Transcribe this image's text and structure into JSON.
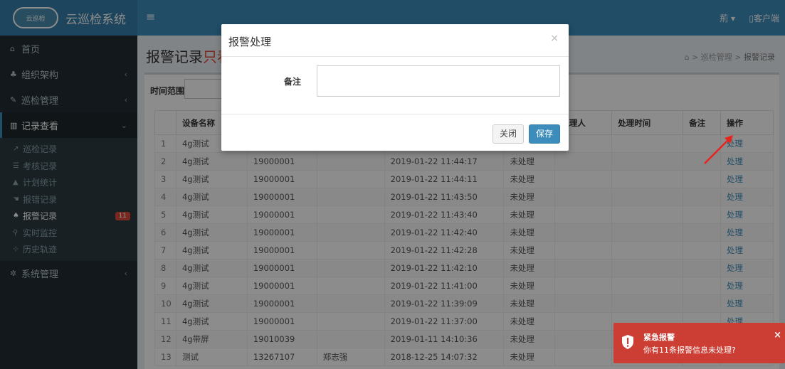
{
  "header": {
    "logo_text": "云巡检",
    "app_title": "云巡检系统",
    "menu_icon": "hamburger-icon",
    "user_label": "荊 ▾",
    "client_label": "客户端"
  },
  "sidebar": {
    "items": [
      {
        "label": "首页",
        "icon": "home-icon"
      },
      {
        "label": "组织架构",
        "icon": "sitemap-icon"
      },
      {
        "label": "巡检管理",
        "icon": "wrench-icon"
      },
      {
        "label": "记录查看",
        "icon": "chart-icon"
      },
      {
        "label": "系统管理",
        "icon": "gear-icon"
      }
    ],
    "sub_items": [
      {
        "label": "巡检记录",
        "icon": "line-chart-icon"
      },
      {
        "label": "考核记录",
        "icon": "list-icon"
      },
      {
        "label": "计划统计",
        "icon": "area-chart-icon"
      },
      {
        "label": "报错记录",
        "icon": "hand-icon"
      },
      {
        "label": "报警记录",
        "icon": "bell-icon",
        "badge": "11"
      },
      {
        "label": "实时监控",
        "icon": "map-marker-icon"
      },
      {
        "label": "历史轨迹",
        "icon": "history-icon"
      }
    ]
  },
  "page": {
    "title_prefix": "报警记录",
    "title_red": "只看",
    "breadcrumb": [
      "巡检管理",
      "报警记录"
    ]
  },
  "filter": {
    "label": "时间范围"
  },
  "table": {
    "headers": [
      "",
      "设备名称",
      "",
      "",
      "",
      "",
      "处理人",
      "处理时间",
      "备注",
      "操作"
    ],
    "rows": [
      {
        "idx": "1",
        "name": "4g测试",
        "device": "",
        "person": "",
        "time": "",
        "status": "",
        "op": "处理"
      },
      {
        "idx": "2",
        "name": "4g测试",
        "device": "19000001",
        "person": "",
        "time": "2019-01-22 11:44:17",
        "status": "未处理",
        "op": "处理"
      },
      {
        "idx": "3",
        "name": "4g测试",
        "device": "19000001",
        "person": "",
        "time": "2019-01-22 11:44:11",
        "status": "未处理",
        "op": "处理"
      },
      {
        "idx": "4",
        "name": "4g测试",
        "device": "19000001",
        "person": "",
        "time": "2019-01-22 11:43:50",
        "status": "未处理",
        "op": "处理"
      },
      {
        "idx": "5",
        "name": "4g测试",
        "device": "19000001",
        "person": "",
        "time": "2019-01-22 11:43:40",
        "status": "未处理",
        "op": "处理"
      },
      {
        "idx": "6",
        "name": "4g测试",
        "device": "19000001",
        "person": "",
        "time": "2019-01-22 11:42:40",
        "status": "未处理",
        "op": "处理"
      },
      {
        "idx": "7",
        "name": "4g测试",
        "device": "19000001",
        "person": "",
        "time": "2019-01-22 11:42:28",
        "status": "未处理",
        "op": "处理"
      },
      {
        "idx": "8",
        "name": "4g测试",
        "device": "19000001",
        "person": "",
        "time": "2019-01-22 11:42:10",
        "status": "未处理",
        "op": "处理"
      },
      {
        "idx": "9",
        "name": "4g测试",
        "device": "19000001",
        "person": "",
        "time": "2019-01-22 11:41:00",
        "status": "未处理",
        "op": "处理"
      },
      {
        "idx": "10",
        "name": "4g测试",
        "device": "19000001",
        "person": "",
        "time": "2019-01-22 11:39:09",
        "status": "未处理",
        "op": "处理"
      },
      {
        "idx": "11",
        "name": "4g测试",
        "device": "19000001",
        "person": "",
        "time": "2019-01-22 11:37:00",
        "status": "未处理",
        "op": "处理"
      },
      {
        "idx": "12",
        "name": "4g带屏",
        "device": "19010039",
        "person": "",
        "time": "2019-01-11 14:10:36",
        "status": "未处理",
        "op": "处理"
      },
      {
        "idx": "13",
        "name": "测试",
        "device": "13267107",
        "person": "郑志强",
        "time": "2018-12-25 14:07:32",
        "status": "未处理",
        "op": "处理"
      }
    ]
  },
  "modal": {
    "title": "报警处理",
    "close_symbol": "×",
    "note_label": "备注",
    "note_value": "",
    "close_button": "关闭",
    "save_button": "保存"
  },
  "toast": {
    "title": "紧急报警",
    "message": "你有11条报警信息未处理?",
    "close_symbol": "×",
    "color": "#cc3d33"
  },
  "colors": {
    "primary": "#3c8dbc",
    "sidebar": "#222d32",
    "danger": "#dd4b39",
    "arrow": "#e8251c"
  }
}
